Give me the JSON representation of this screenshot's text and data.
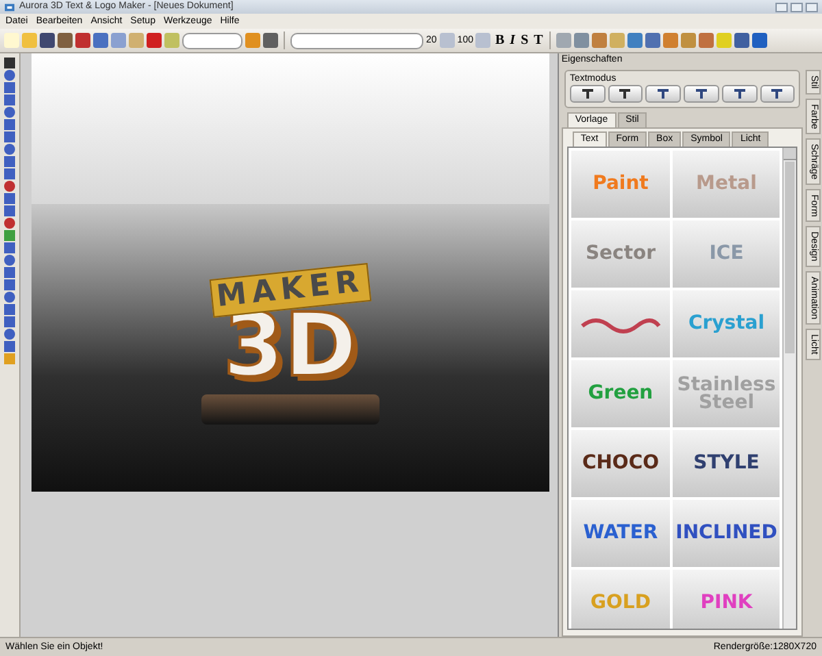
{
  "window": {
    "title": "Aurora 3D Text & Logo Maker - [Neues Dokument]"
  },
  "menu": [
    "Datei",
    "Bearbeiten",
    "Ansicht",
    "Setup",
    "Werkzeuge",
    "Hilfe"
  ],
  "toolbar": {
    "size_values": [
      "20",
      "100"
    ],
    "format_buttons": [
      "B",
      "I",
      "S",
      "T"
    ]
  },
  "canvas": {
    "logo_top": "MAKER",
    "logo_bottom": "3D"
  },
  "panel": {
    "title": "Eigenschaften",
    "group": "Textmodus",
    "tabs": [
      {
        "label": "Vorlage",
        "selected": true
      },
      {
        "label": "Stil",
        "selected": false
      }
    ],
    "subtabs": [
      {
        "label": "Text",
        "selected": true
      },
      {
        "label": "Form",
        "selected": false
      },
      {
        "label": "Box",
        "selected": false
      },
      {
        "label": "Symbol",
        "selected": false
      },
      {
        "label": "Licht",
        "selected": false
      }
    ],
    "presets": [
      {
        "label": "Paint",
        "color": "#f07a1e"
      },
      {
        "label": "Metal",
        "color": "#b89a8c"
      },
      {
        "label": "Sector",
        "color": "#8a8480"
      },
      {
        "label": "ICE",
        "color": "#8a98a8"
      },
      {
        "color": "#c04050"
      },
      {
        "label": "Crystal",
        "color": "#2aa0d0"
      },
      {
        "label": "Green",
        "color": "#22a040"
      },
      {
        "label": "Stainless Steel",
        "color": "#a0a0a0"
      },
      {
        "label": "CHOCO",
        "color": "#5a2a18"
      },
      {
        "label": "STYLE",
        "color": "#304070"
      },
      {
        "label": "WATER",
        "color": "#2a60d0"
      },
      {
        "label": "INCLINED",
        "color": "#3050c0"
      },
      {
        "label": "GOLD",
        "color": "#d8a020"
      },
      {
        "label": "PINK",
        "color": "#e040c0"
      }
    ]
  },
  "side_tabs": [
    {
      "label": "Stil",
      "selected": false
    },
    {
      "label": "Farbe",
      "selected": false
    },
    {
      "label": "Schräge",
      "selected": false
    },
    {
      "label": "Form",
      "selected": false
    },
    {
      "label": "Design",
      "selected": false
    },
    {
      "label": "Animation",
      "selected": false
    },
    {
      "label": "Licht",
      "selected": false
    }
  ],
  "status_bar": {
    "message": "Wählen Sie ein Objekt!",
    "render_size": "Rendergröße:1280X720"
  }
}
